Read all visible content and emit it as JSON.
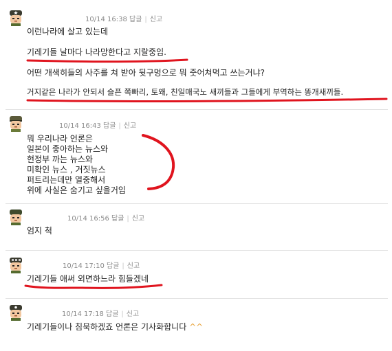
{
  "comments": [
    {
      "time": "10/14 16:38",
      "reply_label": "답글",
      "report_label": "신고",
      "avatar": "soldier-avatar-icon",
      "lines": [
        "이런나라에 살고 있는데",
        "기레기들 날마다 나라망한다고 지랄중임.",
        "어떤 개색히들의 사주를 쳐 받아 뒷구멍으로 뭐 줏어쳐먹고 쓰는거냐?",
        "거지같은 나라가 안되서 슬픈 쪽빠리, 토왜, 친일매국노 새끼들과 그들에게 부역하는 똥개새끼들."
      ]
    },
    {
      "time": "10/14 16:43",
      "reply_label": "답글",
      "report_label": "신고",
      "avatar": "soldier-avatar-icon",
      "lines": [
        "뭐 우리나라 언론은",
        "일본이 좋아하는 뉴스와",
        "현정부 까는 뉴스와",
        "미확인 뉴스 , 거짓뉴스",
        "퍼트리는데만 열중해서",
        "위에 사실은 숨기고 싶을거임"
      ]
    },
    {
      "time": "10/14 16:56",
      "reply_label": "답글",
      "report_label": "신고",
      "avatar": "soldier-avatar-icon",
      "lines": [
        "엄지 척"
      ]
    },
    {
      "time": "10/14 17:10",
      "reply_label": "답글",
      "report_label": "신고",
      "avatar": "soldier-avatar-icon",
      "lines": [
        "기레기들 애써 외면하느라 힘들겠네"
      ]
    },
    {
      "time": "10/14 17:18",
      "reply_label": "답글",
      "report_label": "신고",
      "avatar": "soldier-avatar-icon",
      "lines": [
        "기레기들이나 침묵하겠죠 언론은 기사화합니다"
      ],
      "emote": "^^"
    }
  ],
  "annotation_color": "#e0141e"
}
